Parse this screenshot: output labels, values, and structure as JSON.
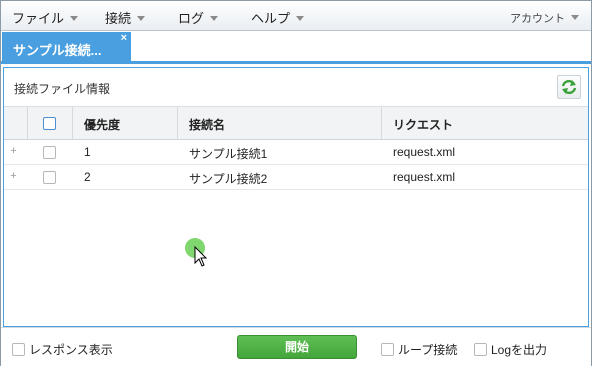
{
  "menubar": {
    "items": [
      {
        "label": "ファイル"
      },
      {
        "label": "接続"
      },
      {
        "label": "ログ"
      },
      {
        "label": "ヘルプ"
      }
    ],
    "account_label": "アカウント"
  },
  "tabs": [
    {
      "label": "サンプル接続...",
      "close": "×"
    }
  ],
  "panel": {
    "title": "接続ファイル情報"
  },
  "table": {
    "columns": [
      "優先度",
      "接続名",
      "リクエスト"
    ],
    "rows": [
      {
        "expand": "+",
        "priority": "1",
        "name": "サンプル接続1",
        "request": "request.xml"
      },
      {
        "expand": "+",
        "priority": "2",
        "name": "サンプル接続2",
        "request": "request.xml"
      }
    ]
  },
  "footer": {
    "response_label": "レスポンス表示",
    "start_label": "開始",
    "loop_label": "ループ接続",
    "log_label": "Logを出力"
  },
  "colors": {
    "accent": "#4a9fe0",
    "start_button": "#4caf45",
    "click_highlight": "#72d25f"
  }
}
